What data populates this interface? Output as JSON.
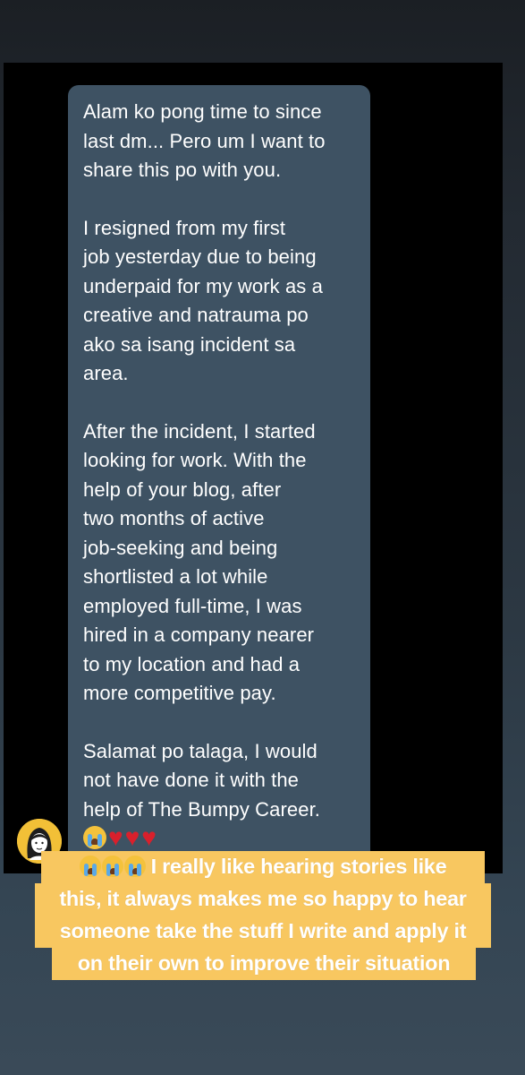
{
  "message": {
    "paragraphs": [
      "Alam ko pong time to since\nlast dm... Pero um I want to\nshare this po with you.",
      "I resigned from my first\njob yesterday due to being\nunderpaid for my work as a\ncreative and natrauma po\nako sa isang incident sa\narea.",
      "After the incident, I started\nlooking for work. With the\nhelp of your blog, after\ntwo months of active\njob-seeking and being\nshortlisted a lot while\nemployed full-time, I was\nhired in a company nearer\nto my location and had a\nmore competitive pay.",
      "Salamat po talaga, I would\nnot have done it with the\nhelp of The Bumpy Career."
    ],
    "reaction_icons": [
      "crying-face-icon",
      "heart-icon",
      "heart-icon",
      "heart-icon"
    ],
    "heart_glyph": "♥"
  },
  "caption": {
    "lines": [
      "I really like hearing stories like",
      "this, it always makes me so happy to hear",
      "someone take the stuff I write and apply it",
      "on their own to improve their situation"
    ],
    "leading_icons": [
      "crying-face-icon",
      "crying-face-icon",
      "crying-face-icon"
    ]
  },
  "colors": {
    "bubble": "#3e5263",
    "caption_highlight": "#f8c760",
    "avatar_bg": "#f2c037"
  }
}
